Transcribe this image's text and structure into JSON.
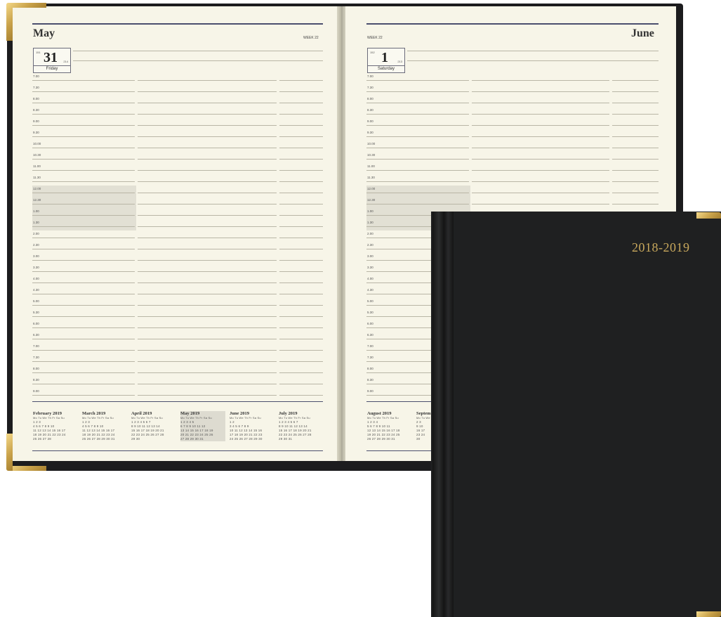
{
  "left_page": {
    "month": "May",
    "week": "WEEK 22",
    "date_number": "31",
    "day_name": "Friday",
    "date_small_top": "151",
    "date_small_right": "214"
  },
  "right_page": {
    "month": "June",
    "week": "WEEK 22",
    "date_number": "1",
    "day_name": "Saturday",
    "date_small_top": "152",
    "date_small_right": "213"
  },
  "times": [
    "7.00",
    "7.30",
    "8.00",
    "8.30",
    "9.00",
    "9.30",
    "10.00",
    "10.30",
    "11.00",
    "11.30",
    "12.00",
    "12.30",
    "1.00",
    "1.30",
    "2.00",
    "2.30",
    "3.00",
    "3.30",
    "4.00",
    "4.30",
    "5.00",
    "5.30",
    "6.00",
    "6.30",
    "7.00",
    "7.30",
    "8.00",
    "8.30",
    "9.00"
  ],
  "weekday_header": "Mo Tu We Th Fr Sa Su",
  "mini_calendars_left": [
    {
      "title": "February 2019",
      "rows": [
        "              1  2  3",
        "4  5  6  7  8  9 10",
        "11 12 13 14 15 16 17",
        "18 19 20 21 22 23 24",
        "25 26 27 28"
      ]
    },
    {
      "title": "March 2019",
      "rows": [
        "              1  2  3",
        "4  5  6  7  8  9 10",
        "11 12 13 14 15 16 17",
        "18 19 20 21 22 23 24",
        "25 26 27 28 29 30 31"
      ]
    },
    {
      "title": "April 2019",
      "rows": [
        "1  2  3  4  5  6  7",
        "8  9 10 11 12 13 14",
        "15 16 17 18 19 20 21",
        "22 23 24 25 26 27 28",
        "29 30"
      ]
    },
    {
      "title": "May 2019",
      "rows": [
        "        1  2  3  4  5",
        "6  7  8  9 10 11 12",
        "13 14 15 16 17 18 19",
        "20 21 22 23 24 25 26",
        "27 28 29 30 31"
      ]
    },
    {
      "title": "June 2019",
      "rows": [
        "                    1  2",
        "3  4  5  6  7  8  9",
        "10 11 12 13 14 15 16",
        "17 18 19 20 21 22 23",
        "24 25 26 27 28 29 30"
      ]
    },
    {
      "title": "July 2019",
      "rows": [
        "1  2  3  4  5  6  7",
        "8  9 10 11 12 13 14",
        "15 16 17 18 19 20 21",
        "22 23 24 25 26 27 28",
        "29 30 31"
      ]
    }
  ],
  "mini_calendars_right": [
    {
      "title": "August 2019",
      "rows": [
        "           1  2  3  4",
        "5  6  7  8  9 10 11",
        "12 13 14 15 16 17 18",
        "19 20 21 22 23 24 25",
        "26 27 28 29 30 31"
      ]
    },
    {
      "title": "Septem",
      "rows": [
        "",
        "2  3",
        "9 10",
        "16 17",
        "23 24",
        "30"
      ]
    }
  ],
  "cover": {
    "year": "2018-2019"
  },
  "colors": {
    "cover": "#1f2021",
    "gold": "#c8a85c",
    "paper": "#f7f5e8",
    "rule_dark": "#4b4f6e"
  }
}
